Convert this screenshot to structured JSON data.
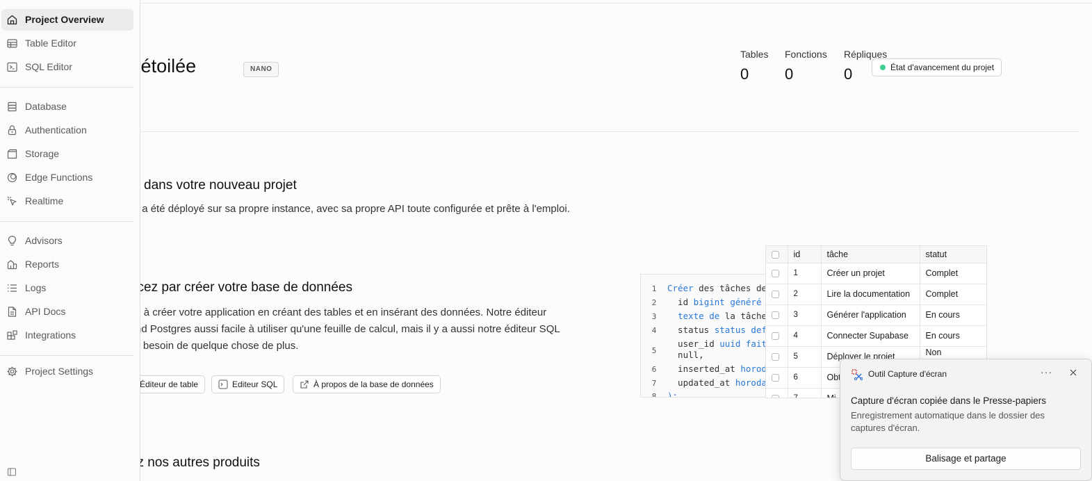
{
  "sidebar": {
    "items": [
      {
        "label": "Project Overview",
        "icon": "home-icon"
      },
      {
        "label": "Table Editor",
        "icon": "table-icon"
      },
      {
        "label": "SQL Editor",
        "icon": "terminal-icon"
      },
      {
        "label": "Database",
        "icon": "database-icon"
      },
      {
        "label": "Authentication",
        "icon": "lock-icon"
      },
      {
        "label": "Storage",
        "icon": "archive-icon"
      },
      {
        "label": "Edge Functions",
        "icon": "globe-icon"
      },
      {
        "label": "Realtime",
        "icon": "cursor-icon"
      },
      {
        "label": "Advisors",
        "icon": "lightbulb-icon"
      },
      {
        "label": "Reports",
        "icon": "chart-icon"
      },
      {
        "label": "Logs",
        "icon": "list-icon"
      },
      {
        "label": "API Docs",
        "icon": "file-icon"
      },
      {
        "label": "Integrations",
        "icon": "blocks-icon"
      },
      {
        "label": "Project Settings",
        "icon": "gear-icon"
      }
    ]
  },
  "header": {
    "project_title": "ène étoilée",
    "plan_badge": "NANO",
    "stats": [
      {
        "label": "Tables",
        "value": "0"
      },
      {
        "label": "Fonctions",
        "value": "0"
      },
      {
        "label": "Répliques",
        "value": "0"
      }
    ],
    "status_label": "État d'avancement du projet"
  },
  "welcome": {
    "title": "venue dans votre nouveau projet",
    "description": "e projet a été déployé sur sa propre instance, avec sa propre API toute configurée et prête à l'emploi."
  },
  "database_section": {
    "title": "nmencez par créer votre base de données",
    "description_lines": [
      "mencez à créer votre application en créant des tables et en insérant des données. Notre éditeur",
      "bles rend Postgres aussi facile à utiliser qu'une feuille de calcul, mais il y a aussi notre éditeur SQL",
      "us avez besoin de quelque chose de plus."
    ],
    "buttons": {
      "table_editor": "Éditeur de table",
      "sql_editor": "Editeur SQL",
      "about_db": "À propos de la base de données"
    }
  },
  "products": {
    "title": "ouvrez nos autres produits"
  },
  "code_sample": {
    "lines": [
      {
        "n": "1",
        "kw": "Créer",
        "text": " des tâches de"
      },
      {
        "n": "2",
        "pre": "  id ",
        "kw": "bigint généré p",
        "text": ""
      },
      {
        "n": "3",
        "pre": "  ",
        "kw": "texte de",
        "text": " la tâche"
      },
      {
        "n": "4",
        "pre": "  status ",
        "kw": "status defa",
        "text": ""
      },
      {
        "n": "5",
        "pre": "  user_id ",
        "kw": "uuid fait",
        "text": "",
        "cont": "  null,"
      },
      {
        "n": "6",
        "pre": "  inserted_at ",
        "kw": "horoda",
        "text": ""
      },
      {
        "n": "7",
        "pre": "  updated_at ",
        "kw": "horodat",
        "text": ""
      },
      {
        "n": "8",
        "pre": "",
        "kw": ");",
        "text": ""
      }
    ]
  },
  "sample_table": {
    "headers": [
      "id",
      "tâche",
      "statut"
    ],
    "rows": [
      {
        "id": "1",
        "task": "Créer un projet",
        "status": "Complet"
      },
      {
        "id": "2",
        "task": "Lire la documentation",
        "status": "Complet"
      },
      {
        "id": "3",
        "task": "Générer l'application",
        "status": "En cours"
      },
      {
        "id": "4",
        "task": "Connecter Supabase",
        "status": "En cours"
      },
      {
        "id": "5",
        "task": "Déployer le projet",
        "status": "Non"
      },
      {
        "id": "6",
        "task": "Obt",
        "status": ""
      },
      {
        "id": "7",
        "task": "Mi",
        "status": ""
      }
    ]
  },
  "toast": {
    "app_name": "Outil Capture d'écran",
    "more": "···",
    "title": "Capture d'écran copiée dans le Presse-papiers",
    "body": "Enregistrement automatique dans le dossier des captures d'écran.",
    "action": "Balisage et partage"
  },
  "colors": {
    "accent_green": "#3ecf8e",
    "keyword_blue": "#2779d8"
  }
}
